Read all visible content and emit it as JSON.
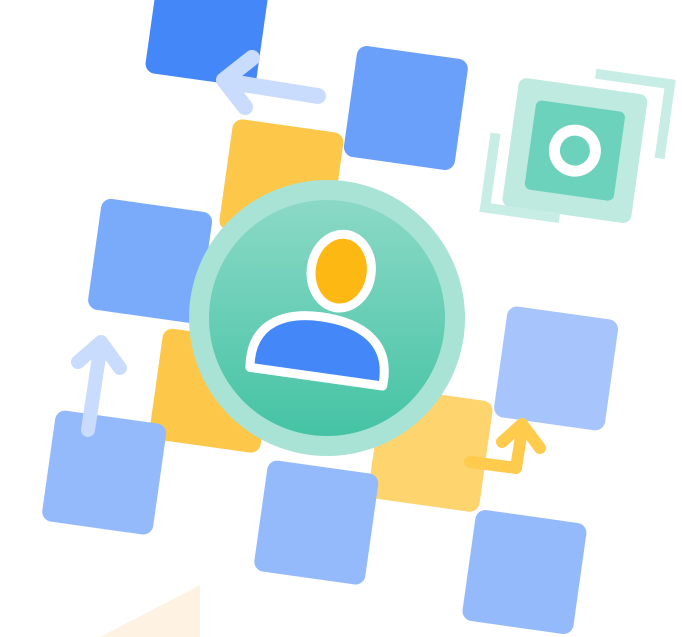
{
  "illustration": {
    "subject": "user-avatar-with-tiles",
    "colors": {
      "blue_dark": "#4387F8",
      "blue_mid": "#6A9FFA",
      "blue_light": "#94BAFB",
      "blue_pale": "#A7C5FC",
      "yellow": "#FDC849",
      "yellow_light": "#FED46E",
      "green_ring": "#A8E3D6",
      "green_grad_top": "#8BD9C6",
      "green_grad_bottom": "#45C3A4",
      "arrow_blue": "#C9DCFD",
      "arrow_yellow": "#FFCB4D",
      "user_head": "#FDB813",
      "user_body": "#4387F8",
      "camera_green": "#6DD2BC"
    },
    "icons": [
      "user-icon",
      "camera-focus-icon",
      "arrow-left-icon",
      "arrow-up-icon",
      "arrow-up-right-icon"
    ]
  }
}
